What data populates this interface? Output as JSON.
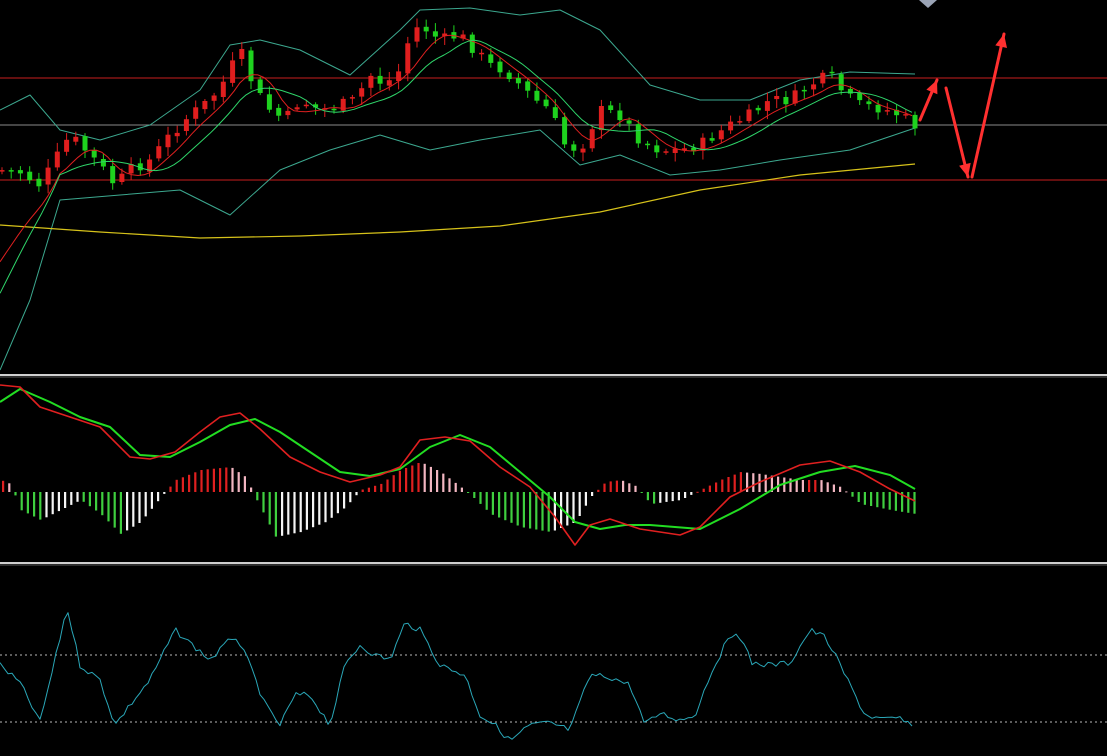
{
  "chart_data": [
    {
      "type": "candlestick",
      "panel": "price",
      "ylim": [
        0,
        375
      ],
      "xlim": [
        0,
        1107
      ],
      "grid": false,
      "horizontal_lines": [
        {
          "y": 78,
          "color": "#c81e1e"
        },
        {
          "y": 125,
          "color": "#8a8a8a"
        },
        {
          "y": 180,
          "color": "#c81e1e"
        }
      ],
      "anchors": [
        [
          0,
          170
        ],
        [
          20,
          172
        ],
        [
          40,
          185
        ],
        [
          55,
          160
        ],
        [
          70,
          135
        ],
        [
          85,
          150
        ],
        [
          100,
          165
        ],
        [
          115,
          185
        ],
        [
          130,
          170
        ],
        [
          150,
          160
        ],
        [
          170,
          135
        ],
        [
          190,
          115
        ],
        [
          210,
          100
        ],
        [
          225,
          80
        ],
        [
          240,
          50
        ],
        [
          255,
          90
        ],
        [
          270,
          110
        ],
        [
          285,
          120
        ],
        [
          300,
          100
        ],
        [
          320,
          110
        ],
        [
          340,
          105
        ],
        [
          355,
          100
        ],
        [
          370,
          75
        ],
        [
          385,
          85
        ],
        [
          400,
          70
        ],
        [
          410,
          35
        ],
        [
          420,
          25
        ],
        [
          440,
          40
        ],
        [
          460,
          35
        ],
        [
          475,
          50
        ],
        [
          490,
          65
        ],
        [
          505,
          70
        ],
        [
          520,
          85
        ],
        [
          535,
          100
        ],
        [
          550,
          110
        ],
        [
          565,
          145
        ],
        [
          580,
          150
        ],
        [
          600,
          110
        ],
        [
          620,
          115
        ],
        [
          640,
          140
        ],
        [
          660,
          150
        ],
        [
          680,
          150
        ],
        [
          700,
          145
        ],
        [
          715,
          135
        ],
        [
          730,
          125
        ],
        [
          750,
          115
        ],
        [
          770,
          100
        ],
        [
          790,
          100
        ],
        [
          810,
          85
        ],
        [
          830,
          75
        ],
        [
          845,
          95
        ],
        [
          860,
          105
        ],
        [
          880,
          108
        ],
        [
          900,
          115
        ],
        [
          915,
          125
        ]
      ],
      "candles_count": 100,
      "candle_colors": {
        "up": "#e01e1e",
        "down": "#1ed21e"
      },
      "moving_averages": [
        {
          "color": "#e02020",
          "offset": 12,
          "smooth": 6
        },
        {
          "color": "#2fd56a",
          "offset": 22,
          "smooth": 11
        }
      ],
      "long_ma": {
        "color": "#d6c21a",
        "points": [
          [
            0,
            225
          ],
          [
            100,
            232
          ],
          [
            200,
            238
          ],
          [
            300,
            236
          ],
          [
            400,
            232
          ],
          [
            500,
            226
          ],
          [
            600,
            212
          ],
          [
            700,
            190
          ],
          [
            800,
            175
          ],
          [
            915,
            164
          ]
        ]
      },
      "bollinger": {
        "color": "#3ca88f",
        "upper": [
          [
            0,
            110
          ],
          [
            30,
            95
          ],
          [
            60,
            130
          ],
          [
            100,
            140
          ],
          [
            150,
            125
          ],
          [
            200,
            90
          ],
          [
            230,
            45
          ],
          [
            260,
            40
          ],
          [
            300,
            50
          ],
          [
            350,
            75
          ],
          [
            400,
            30
          ],
          [
            420,
            10
          ],
          [
            470,
            8
          ],
          [
            520,
            15
          ],
          [
            560,
            10
          ],
          [
            600,
            30
          ],
          [
            650,
            85
          ],
          [
            700,
            100
          ],
          [
            750,
            100
          ],
          [
            800,
            80
          ],
          [
            850,
            72
          ],
          [
            915,
            74
          ]
        ],
        "lower": [
          [
            0,
            370
          ],
          [
            30,
            300
          ],
          [
            60,
            200
          ],
          [
            120,
            195
          ],
          [
            180,
            190
          ],
          [
            230,
            215
          ],
          [
            280,
            170
          ],
          [
            330,
            150
          ],
          [
            380,
            135
          ],
          [
            430,
            150
          ],
          [
            480,
            140
          ],
          [
            540,
            130
          ],
          [
            580,
            165
          ],
          [
            620,
            155
          ],
          [
            670,
            175
          ],
          [
            720,
            170
          ],
          [
            780,
            160
          ],
          [
            850,
            150
          ],
          [
            915,
            128
          ]
        ]
      },
      "arrows": [
        {
          "from": [
            920,
            120
          ],
          "to": [
            937,
            80
          ],
          "color": "#ff3030"
        },
        {
          "from": [
            946,
            88
          ],
          "to": [
            968,
            177
          ],
          "color": "#ff3030"
        },
        {
          "from": [
            972,
            177
          ],
          "to": [
            1004,
            34
          ],
          "color": "#ff3030"
        }
      ],
      "marker": {
        "x": 928,
        "y": 0,
        "color": "#9aa3b5"
      }
    },
    {
      "type": "macd",
      "panel": "macd",
      "ylim": [
        0,
        187
      ],
      "dif": {
        "color": "#e02020",
        "points": [
          [
            0,
            8
          ],
          [
            20,
            10
          ],
          [
            40,
            30
          ],
          [
            70,
            40
          ],
          [
            100,
            50
          ],
          [
            130,
            80
          ],
          [
            150,
            82
          ],
          [
            175,
            75
          ],
          [
            200,
            55
          ],
          [
            220,
            40
          ],
          [
            240,
            36
          ],
          [
            260,
            52
          ],
          [
            290,
            80
          ],
          [
            320,
            95
          ],
          [
            350,
            105
          ],
          [
            380,
            98
          ],
          [
            400,
            90
          ],
          [
            420,
            63
          ],
          [
            445,
            60
          ],
          [
            470,
            64
          ],
          [
            500,
            90
          ],
          [
            530,
            110
          ],
          [
            555,
            140
          ],
          [
            575,
            168
          ],
          [
            590,
            148
          ],
          [
            610,
            142
          ],
          [
            640,
            152
          ],
          [
            680,
            158
          ],
          [
            700,
            150
          ],
          [
            730,
            120
          ],
          [
            760,
            105
          ],
          [
            800,
            88
          ],
          [
            830,
            84
          ],
          [
            860,
            95
          ],
          [
            890,
            112
          ],
          [
            915,
            124
          ]
        ]
      },
      "dea": {
        "color": "#22dd22",
        "points": [
          [
            0,
            25
          ],
          [
            20,
            12
          ],
          [
            50,
            25
          ],
          [
            80,
            40
          ],
          [
            110,
            50
          ],
          [
            140,
            78
          ],
          [
            170,
            80
          ],
          [
            200,
            65
          ],
          [
            230,
            48
          ],
          [
            255,
            42
          ],
          [
            280,
            55
          ],
          [
            310,
            75
          ],
          [
            340,
            95
          ],
          [
            370,
            99
          ],
          [
            400,
            92
          ],
          [
            430,
            70
          ],
          [
            460,
            58
          ],
          [
            490,
            70
          ],
          [
            520,
            95
          ],
          [
            550,
            120
          ],
          [
            575,
            145
          ],
          [
            600,
            152
          ],
          [
            625,
            148
          ],
          [
            650,
            148
          ],
          [
            700,
            152
          ],
          [
            740,
            132
          ],
          [
            780,
            108
          ],
          [
            820,
            95
          ],
          [
            855,
            89
          ],
          [
            890,
            98
          ],
          [
            915,
            112
          ]
        ]
      },
      "histogram": {
        "zero_y": 115,
        "colors": {
          "pos_up": "#e02020",
          "pos_down": "#f2b6c1",
          "neg_up": "#3fcf3f",
          "neg_down": "#f5f5f5"
        },
        "profile": [
          [
            0,
            12
          ],
          [
            10,
            8
          ],
          [
            20,
            -18
          ],
          [
            40,
            -28
          ],
          [
            60,
            -18
          ],
          [
            80,
            -8
          ],
          [
            100,
            -22
          ],
          [
            120,
            -42
          ],
          [
            140,
            -30
          ],
          [
            158,
            -8
          ],
          [
            175,
            12
          ],
          [
            200,
            22
          ],
          [
            230,
            25
          ],
          [
            245,
            15
          ],
          [
            255,
            -6
          ],
          [
            275,
            -45
          ],
          [
            300,
            -40
          ],
          [
            325,
            -30
          ],
          [
            345,
            -15
          ],
          [
            360,
            2
          ],
          [
            380,
            8
          ],
          [
            400,
            22
          ],
          [
            420,
            30
          ],
          [
            440,
            20
          ],
          [
            460,
            5
          ],
          [
            470,
            -3
          ],
          [
            490,
            -22
          ],
          [
            520,
            -35
          ],
          [
            550,
            -40
          ],
          [
            575,
            -30
          ],
          [
            590,
            -5
          ],
          [
            605,
            10
          ],
          [
            620,
            12
          ],
          [
            635,
            6
          ],
          [
            650,
            -12
          ],
          [
            680,
            -8
          ],
          [
            700,
            2
          ],
          [
            720,
            12
          ],
          [
            740,
            20
          ],
          [
            760,
            18
          ],
          [
            780,
            15
          ],
          [
            800,
            12
          ],
          [
            820,
            12
          ],
          [
            840,
            5
          ],
          [
            860,
            -12
          ],
          [
            890,
            -18
          ],
          [
            915,
            -22
          ]
        ]
      }
    },
    {
      "type": "line",
      "panel": "oscillator",
      "ylim": [
        0,
        187
      ],
      "levels": [
        90,
        157
      ],
      "line": {
        "color": "#2aa7b8",
        "points": [
          [
            0,
            100
          ],
          [
            20,
            118
          ],
          [
            40,
            157
          ],
          [
            55,
            95
          ],
          [
            67,
            42
          ],
          [
            80,
            100
          ],
          [
            100,
            115
          ],
          [
            115,
            160
          ],
          [
            130,
            140
          ],
          [
            150,
            115
          ],
          [
            165,
            85
          ],
          [
            175,
            65
          ],
          [
            190,
            78
          ],
          [
            210,
            95
          ],
          [
            235,
            70
          ],
          [
            250,
            100
          ],
          [
            265,
            140
          ],
          [
            280,
            160
          ],
          [
            295,
            130
          ],
          [
            310,
            130
          ],
          [
            330,
            160
          ],
          [
            345,
            100
          ],
          [
            360,
            80
          ],
          [
            375,
            90
          ],
          [
            390,
            95
          ],
          [
            405,
            58
          ],
          [
            420,
            65
          ],
          [
            440,
            100
          ],
          [
            465,
            110
          ],
          [
            480,
            150
          ],
          [
            495,
            160
          ],
          [
            510,
            176
          ],
          [
            530,
            160
          ],
          [
            550,
            158
          ],
          [
            570,
            165
          ],
          [
            590,
            110
          ],
          [
            610,
            112
          ],
          [
            630,
            120
          ],
          [
            645,
            160
          ],
          [
            660,
            148
          ],
          [
            680,
            155
          ],
          [
            695,
            150
          ],
          [
            710,
            110
          ],
          [
            725,
            80
          ],
          [
            737,
            65
          ],
          [
            752,
            98
          ],
          [
            770,
            100
          ],
          [
            790,
            98
          ],
          [
            810,
            65
          ],
          [
            825,
            72
          ],
          [
            835,
            90
          ],
          [
            850,
            120
          ],
          [
            865,
            150
          ],
          [
            885,
            155
          ],
          [
            900,
            153
          ],
          [
            915,
            165
          ]
        ]
      }
    }
  ]
}
